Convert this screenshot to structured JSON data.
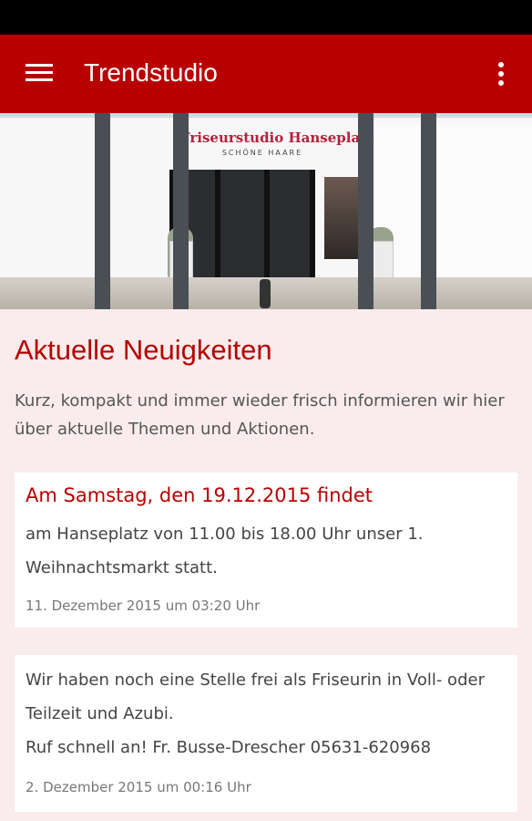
{
  "app_bar": {
    "title": "Trendstudio",
    "menu_icon": "hamburger-menu-icon",
    "overflow_icon": "more-vertical-icon",
    "color": "#b80000"
  },
  "hero_image": {
    "sign_title": "Friseurstudio Hanseplatz",
    "sign_subtitle": "SCHÖNE HAARE"
  },
  "section": {
    "title": "Aktuelle Neuigkeiten",
    "intro": "Kurz, kompakt und immer wieder frisch informieren wir hier über aktuelle Themen und Aktionen."
  },
  "posts": [
    {
      "title": "Am Samstag, den 19.12.2015 findet",
      "body": "am Hanseplatz von 11.00 bis 18.00 Uhr unser 1. Weihnachtsmarkt statt.",
      "date": "11. Dezember 2015 um 03:20 Uhr"
    },
    {
      "title": "",
      "body_lines": [
        "Wir haben noch eine Stelle frei als Friseurin in Voll- oder Teilzeit und Azubi.",
        "Ruf schnell an! Fr. Busse-Drescher 05631-620968"
      ],
      "date": "2. Dezember 2015 um 00:16 Uhr"
    }
  ],
  "colors": {
    "accent": "#b80000",
    "background": "#faecec",
    "card": "#ffffff"
  }
}
